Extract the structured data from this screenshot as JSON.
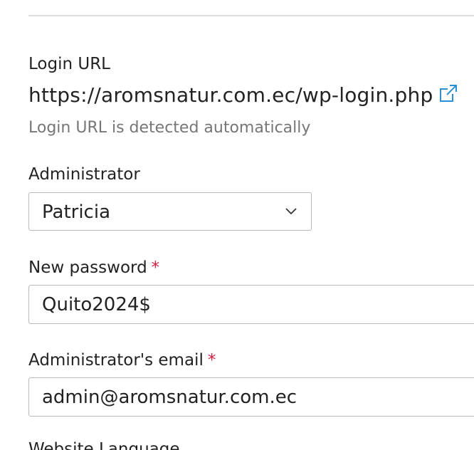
{
  "login_url": {
    "label": "Login URL",
    "value": "https://aromsnatur.com.ec/wp-login.php",
    "hint": "Login URL is detected automatically",
    "link_icon": "external-link-icon"
  },
  "administrator": {
    "label": "Administrator",
    "selected": "Patricia",
    "dropdown_icon": "chevron-down-icon"
  },
  "new_password": {
    "label": "New password",
    "required_mark": "*",
    "value": "Quito2024$"
  },
  "admin_email": {
    "label": "Administrator's email",
    "required_mark": "*",
    "value": "admin@aromsnatur.com.ec"
  },
  "website_language": {
    "label": "Website Language"
  },
  "colors": {
    "required": "#d02040",
    "link_icon": "#2b8fd6",
    "hint_text": "#767676",
    "border": "#b8b8b8"
  }
}
